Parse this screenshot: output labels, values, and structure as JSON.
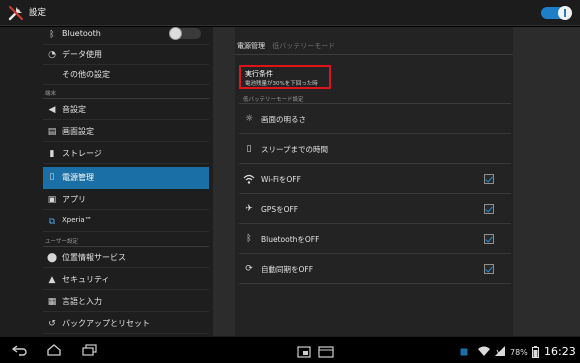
{
  "app": {
    "title": "設定",
    "icon": "settings-tools-icon"
  },
  "sidebar": {
    "items": [
      {
        "label": "Bluetooth",
        "icon": "bluetooth-icon"
      },
      {
        "label": "データ使用",
        "icon": "data-usage-icon"
      },
      {
        "label": "その他の設定",
        "icon": ""
      }
    ],
    "section_device": "端末",
    "device_items": [
      {
        "label": "音設定",
        "icon": "volume-icon"
      },
      {
        "label": "画面設定",
        "icon": "display-icon"
      },
      {
        "label": "ストレージ",
        "icon": "storage-icon"
      },
      {
        "label": "電源管理",
        "icon": "battery-icon"
      },
      {
        "label": "アプリ",
        "icon": "apps-icon"
      },
      {
        "label": "Xperia™",
        "icon": "xperia-icon"
      }
    ],
    "section_user": "ユーザー設定",
    "user_items": [
      {
        "label": "位置情報サービス",
        "icon": "location-icon"
      },
      {
        "label": "セキュリティ",
        "icon": "lock-icon"
      },
      {
        "label": "言語と入力",
        "icon": "keyboard-icon"
      },
      {
        "label": "バックアップとリセット",
        "icon": "backup-icon"
      }
    ]
  },
  "detail": {
    "breadcrumb_current": "電源管理",
    "breadcrumb_sub": "低バッテリーモード",
    "exec_title": "実行条件",
    "exec_desc": "電池残量が30%を下回った時",
    "mode_header": "低バッテリーモード設定",
    "options": [
      {
        "label": "画面の明るさ",
        "icon": "brightness-icon",
        "checkbox": false
      },
      {
        "label": "スリープまでの時間",
        "icon": "sleep-timer-icon",
        "checkbox": false
      },
      {
        "label": "Wi-FiをOFF",
        "icon": "wifi-icon",
        "checkbox": true
      },
      {
        "label": "GPSをOFF",
        "icon": "gps-icon",
        "checkbox": true
      },
      {
        "label": "BluetoothをOFF",
        "icon": "bluetooth-icon",
        "checkbox": true
      },
      {
        "label": "自動同期をOFF",
        "icon": "sync-icon",
        "checkbox": true
      }
    ]
  },
  "statusbar": {
    "battery": "78%",
    "time": "16:23"
  },
  "colors": {
    "accent": "#1a6fa6",
    "highlight_box": "#e0131b",
    "toggle_on": "#1f7fc6"
  }
}
